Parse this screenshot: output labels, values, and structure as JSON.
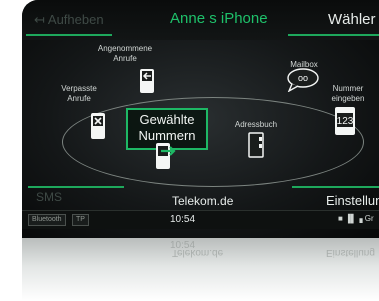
{
  "header": {
    "left_label": "Aufheben",
    "title": "Anne s iPhone",
    "right_label": "Wähler"
  },
  "menu": {
    "accepted_calls": "Angenommene Anrufe",
    "missed_calls": "Verpasste Anrufe",
    "dialed_numbers": "Gewählte Nummern",
    "mailbox": "Mailbox",
    "mailbox_badge": "oo",
    "enter_number": "Nummer eingeben",
    "keypad_digits": "123",
    "address_book": "Adressbuch"
  },
  "bottom": {
    "left_label": "SMS",
    "center_label": "Telekom.de",
    "right_label": "Einstellung"
  },
  "status_bar": {
    "badge1": "Bluetooth",
    "badge2": "TP",
    "time": "10:54",
    "signal_text": "■ ▐▌▗ Gr"
  },
  "reflection": {
    "time": "10:54",
    "center_label": "Telekom.de",
    "right_label": "Einstellung"
  },
  "colors": {
    "accent": "#1eb865",
    "title": "#1ec06a",
    "text": "#e7ecea",
    "dim": "#3f4a46"
  },
  "icons": {
    "back": "arrow-left-icon",
    "accepted": "phone-incoming-icon",
    "missed": "phone-missed-icon",
    "dialed": "phone-outgoing-icon",
    "mailbox": "speech-bubble-icon",
    "keypad": "keypad-icon",
    "address_book": "address-book-icon"
  }
}
